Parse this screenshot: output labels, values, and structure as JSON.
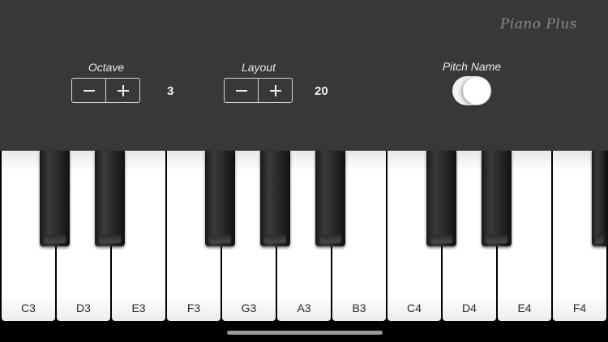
{
  "app": {
    "title": "Piano Plus"
  },
  "controls": {
    "octave": {
      "label": "Octave",
      "value": "3"
    },
    "layout": {
      "label": "Layout",
      "value": "20"
    },
    "pitch_name": {
      "label": "Pitch Name",
      "enabled": true
    }
  },
  "keyboard": {
    "white_keys": [
      "C3",
      "D3",
      "E3",
      "F3",
      "G3",
      "A3",
      "B3",
      "C4",
      "D4",
      "E4",
      "F4"
    ],
    "black_keys": [
      "C#3",
      "D#3",
      "F#3",
      "G#3",
      "A#3",
      "C#4",
      "D#4",
      "F#4"
    ]
  },
  "colors": {
    "panel": "#383838",
    "background": "#000000",
    "white_key": "#ffffff",
    "black_key": "#1a1a1a"
  }
}
